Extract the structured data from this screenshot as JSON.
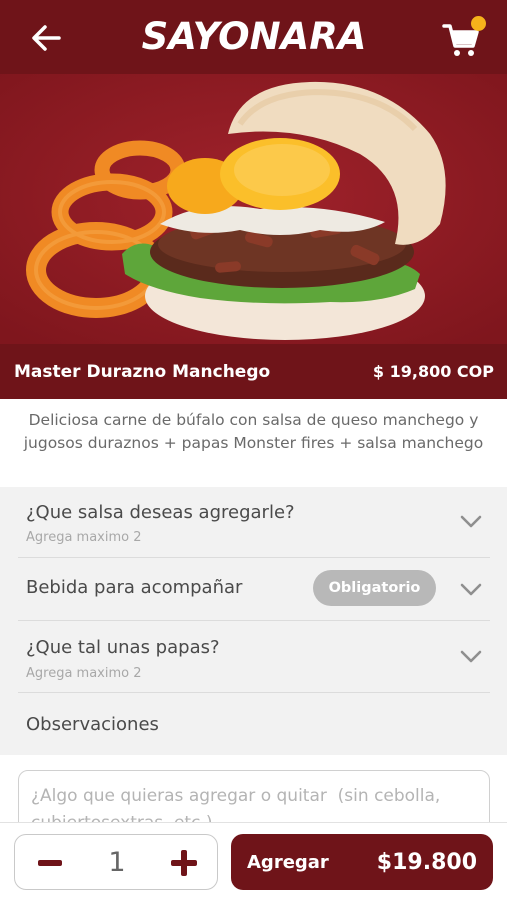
{
  "header": {
    "logo_text": "SAYONARA",
    "back_icon": "arrow-left-icon",
    "cart_icon": "shopping-cart-icon",
    "cart_badge_color": "#f6b21b",
    "brand_color": "#6f1419"
  },
  "product": {
    "name": "Master Durazno Manchego",
    "price": "$ 19,800 COP",
    "description": "Deliciosa carne de búfalo con salsa de queso manchego y jugosos duraznos + papas Monster fires + salsa manchego"
  },
  "options": [
    {
      "title": "¿Que salsa deseas agregarle?",
      "subtitle": "Agrega maximo 2"
    },
    {
      "title": "Bebida para acompañar",
      "badge": "Obligatorio"
    },
    {
      "title": "¿Que tal unas papas?",
      "subtitle": "Agrega maximo 2"
    },
    {
      "title": "Observaciones"
    }
  ],
  "notes": {
    "placeholder": "¿Algo que quieras agregar o quitar  (sin cebolla, cubiertosextras, etc.)"
  },
  "cart_bar": {
    "quantity": "1",
    "add_label": "Agregar",
    "add_price": "$19.800"
  }
}
